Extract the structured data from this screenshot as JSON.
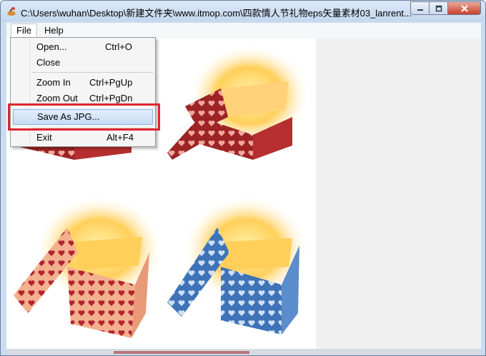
{
  "window": {
    "title": "C:\\Users\\wuhan\\Desktop\\新建文件夹\\www.itmop.com\\四款情人节礼物eps矢量素材03_lanrent..."
  },
  "menubar": {
    "file_label": "File",
    "help_label": "Help"
  },
  "file_menu": {
    "open_label": "Open...",
    "open_shortcut": "Ctrl+O",
    "close_label": "Close",
    "zoom_in_label": "Zoom In",
    "zoom_in_shortcut": "Ctrl+PgUp",
    "zoom_out_label": "Zoom Out",
    "zoom_out_shortcut": "Ctrl+PgDn",
    "save_as_jpg_label": "Save As JPG...",
    "exit_label": "Exit",
    "exit_shortcut": "Alt+F4"
  },
  "image": {
    "boxes": [
      {
        "name": "red-gift-box",
        "color": "#9c2424",
        "heart": "#f2a7a0"
      },
      {
        "name": "red-gift-box",
        "color": "#9c2424",
        "heart": "#f2a7a0"
      },
      {
        "name": "peach-gift-box",
        "color": "#f3b08e",
        "heart": "#b32430"
      },
      {
        "name": "blue-gift-box",
        "color": "#3f73b8",
        "heart": "#cfe0f5"
      }
    ]
  },
  "colors": {
    "highlight": "#e0262e",
    "selection": "#c7dcf5"
  }
}
